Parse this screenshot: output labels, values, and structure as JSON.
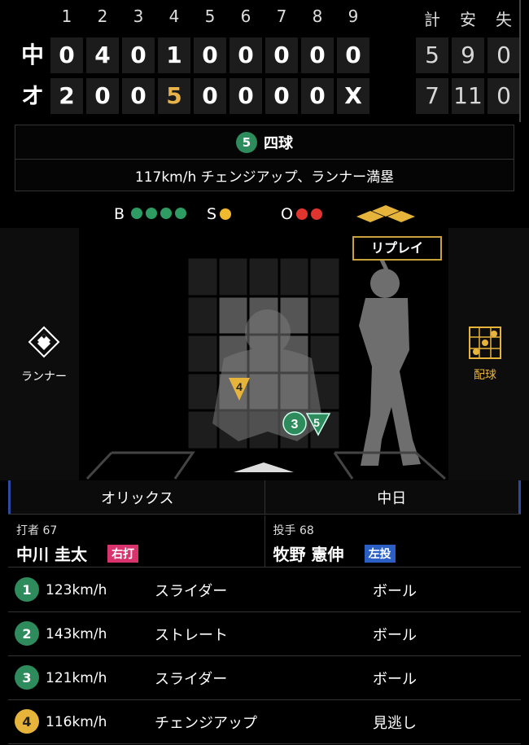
{
  "scoreboard": {
    "innings": [
      "1",
      "2",
      "3",
      "4",
      "5",
      "6",
      "7",
      "8",
      "9"
    ],
    "total_headers": [
      "計",
      "安",
      "失"
    ],
    "teams": [
      {
        "name": "中",
        "scores": [
          "0",
          "4",
          "0",
          "1",
          "0",
          "0",
          "0",
          "0",
          "0"
        ],
        "totals": [
          "5",
          "9",
          "0"
        ]
      },
      {
        "name": "オ",
        "scores": [
          "2",
          "0",
          "0",
          "5",
          "0",
          "0",
          "0",
          "0",
          "X"
        ],
        "totals": [
          "7",
          "11",
          "0"
        ],
        "highlight_inning": 4
      }
    ],
    "highlight_color": "#e8b44a"
  },
  "play": {
    "pitch_number": "5",
    "result": "四球",
    "description": "117km/h チェンジアップ、ランナー満塁"
  },
  "count": {
    "ball_label": "B",
    "balls": 4,
    "strike_label": "S",
    "strikes": 1,
    "out_label": "O",
    "outs": 2
  },
  "field": {
    "runner_label": "ランナー",
    "pitch_chart_label": "配球",
    "replay_label": "リプレイ",
    "markers": [
      {
        "num": "4",
        "shape": "triangle-down",
        "color": "#e6b33b"
      },
      {
        "num": "3",
        "shape": "circle",
        "color": "#2e8b5c"
      },
      {
        "num": "5",
        "shape": "triangle-down",
        "color": "#2e8b5c"
      }
    ]
  },
  "teams_row": {
    "left": "オリックス",
    "right": "中日"
  },
  "batter": {
    "role": "打者",
    "number": "67",
    "name": "中川 圭太",
    "tag": "右打"
  },
  "pitcher": {
    "role": "投手",
    "number": "68",
    "name": "牧野 憲伸",
    "tag": "左投"
  },
  "pitches": [
    {
      "num": "1",
      "speed": "123km/h",
      "type": "スライダー",
      "result": "ボール",
      "color": "green"
    },
    {
      "num": "2",
      "speed": "143km/h",
      "type": "ストレート",
      "result": "ボール",
      "color": "green"
    },
    {
      "num": "3",
      "speed": "121km/h",
      "type": "スライダー",
      "result": "ボール",
      "color": "green"
    },
    {
      "num": "4",
      "speed": "116km/h",
      "type": "チェンジアップ",
      "result": "見逃し",
      "color": "yellow"
    }
  ]
}
